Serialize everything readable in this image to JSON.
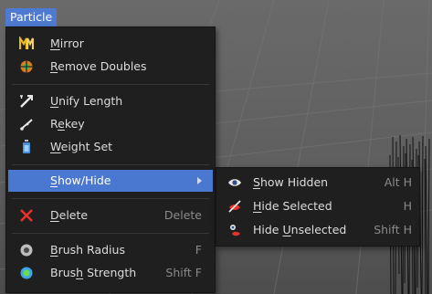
{
  "menu_tab": "Particle",
  "menu": {
    "mirror": {
      "pre": "",
      "u": "M",
      "post": "irror"
    },
    "remove_doubles": {
      "pre": "",
      "u": "R",
      "post": "emove Doubles"
    },
    "unify_length": {
      "pre": "",
      "u": "U",
      "post": "nify Length"
    },
    "rekey": {
      "pre": "R",
      "u": "e",
      "post": "key"
    },
    "weight_set": {
      "pre": "",
      "u": "W",
      "post": "eight Set"
    },
    "show_hide": {
      "pre": "",
      "u": "S",
      "post": "how/Hide"
    },
    "delete": {
      "pre": "",
      "u": "D",
      "post": "elete",
      "shortcut": "Delete"
    },
    "brush_radius": {
      "pre": "",
      "u": "B",
      "post": "rush Radius",
      "shortcut": "F"
    },
    "brush_strength": {
      "pre": "Brus",
      "u": "h",
      "post": " Strength",
      "shortcut": "Shift F"
    }
  },
  "submenu": {
    "show_hidden": {
      "pre": "",
      "u": "S",
      "post": "how Hidden",
      "shortcut": "Alt H"
    },
    "hide_selected": {
      "pre": "",
      "u": "H",
      "post": "ide Selected",
      "shortcut": "H"
    },
    "hide_unselected": {
      "pre": "Hide ",
      "u": "U",
      "post": "nselected",
      "shortcut": "Shift H"
    }
  },
  "colors": {
    "highlight": "#4a78d0",
    "menu_bg": "#1f1f1f",
    "shortcut_text": "#8a8a8a"
  },
  "icons": {
    "mirror": "mirror-icon",
    "remove_doubles": "remove-doubles-icon",
    "unify_length": "unify-length-icon",
    "rekey": "rekey-icon",
    "weight_set": "weight-set-icon",
    "delete": "delete-icon",
    "brush_radius": "brush-radius-icon",
    "brush_strength": "brush-strength-icon",
    "show_hidden": "eye-icon",
    "hide_selected": "hide-selected-icon",
    "hide_unselected": "hide-unselected-icon"
  }
}
